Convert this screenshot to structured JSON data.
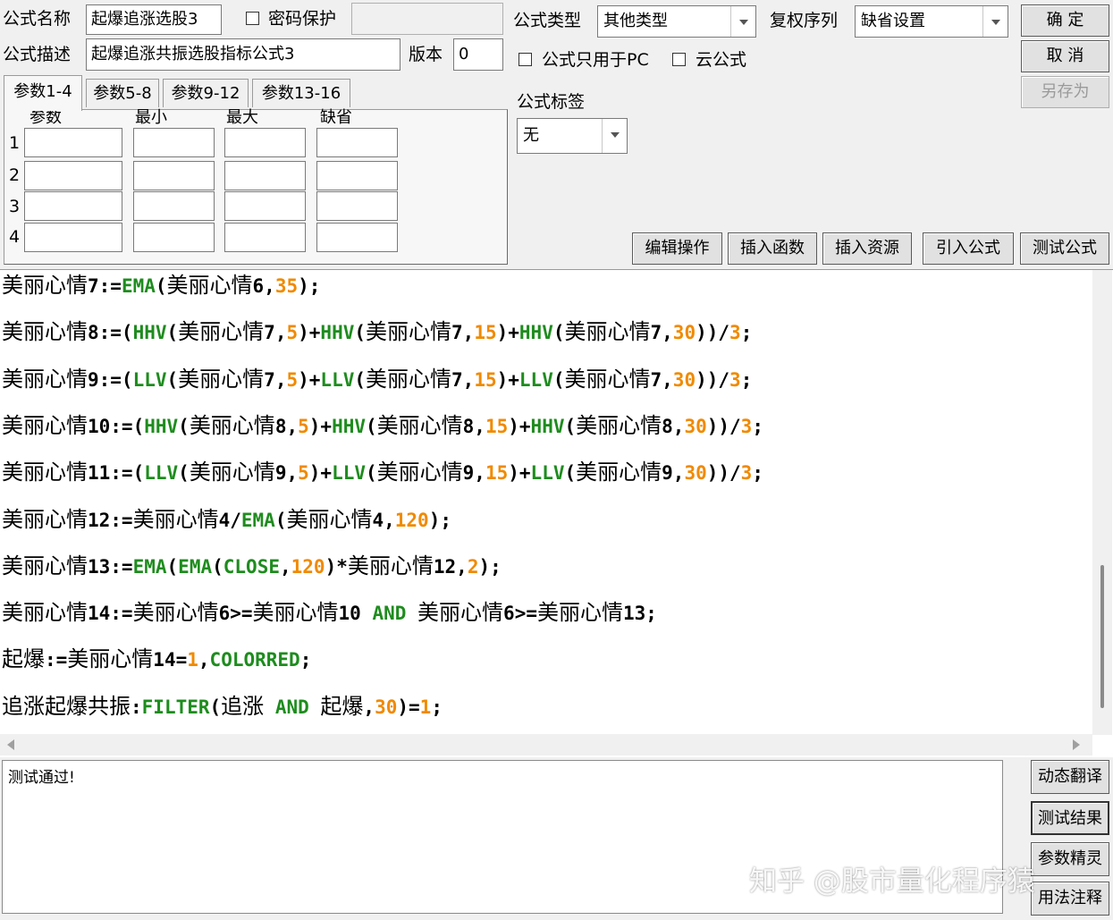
{
  "header": {
    "name_label": "公式名称",
    "name_value": "起爆追涨选股3",
    "password_label": "密码保护",
    "desc_label": "公式描述",
    "desc_value": "起爆追涨共振选股指标公式3",
    "version_label": "版本",
    "version_value": "0",
    "type_label": "公式类型",
    "type_value": "其他类型",
    "rights_label": "复权序列",
    "rights_value": "缺省设置",
    "pc_only_label": "公式只用于PC",
    "cloud_label": "云公式",
    "tag_label": "公式标签",
    "tag_value": "无"
  },
  "buttons": {
    "ok": "确 定",
    "cancel": "取 消",
    "save_as": "另存为",
    "edit_ops": "编辑操作",
    "insert_func": "插入函数",
    "insert_res": "插入资源",
    "import_formula": "引入公式",
    "test_formula": "测试公式"
  },
  "params": {
    "tabs": [
      "参数1-4",
      "参数5-8",
      "参数9-12",
      "参数13-16"
    ],
    "columns": [
      "参数",
      "最小",
      "最大",
      "缺省"
    ],
    "rows": [
      "1",
      "2",
      "3",
      "4"
    ]
  },
  "code_lines": [
    "美丽心情7:=EMA(美丽心情6,35);",
    "美丽心情8:=(HHV(美丽心情7,5)+HHV(美丽心情7,15)+HHV(美丽心情7,30))/3;",
    "美丽心情9:=(LLV(美丽心情7,5)+LLV(美丽心情7,15)+LLV(美丽心情7,30))/3;",
    "美丽心情10:=(HHV(美丽心情8,5)+HHV(美丽心情8,15)+HHV(美丽心情8,30))/3;",
    "美丽心情11:=(LLV(美丽心情9,5)+LLV(美丽心情9,15)+LLV(美丽心情9,30))/3;",
    "美丽心情12:=美丽心情4/EMA(美丽心情4,120);",
    "美丽心情13:=EMA(EMA(CLOSE,120)*美丽心情12,2);",
    "美丽心情14:=美丽心情6>=美丽心情10 AND 美丽心情6>=美丽心情13;",
    "起爆:=美丽心情14=1,COLORRED;",
    "追涨起爆共振:FILTER(追涨 AND 起爆,30)=1;"
  ],
  "output_text": "测试通过!",
  "side_buttons": [
    "动态翻译",
    "测试结果",
    "参数精灵",
    "用法注释"
  ],
  "watermark": "知乎 @股市量化程序猿"
}
